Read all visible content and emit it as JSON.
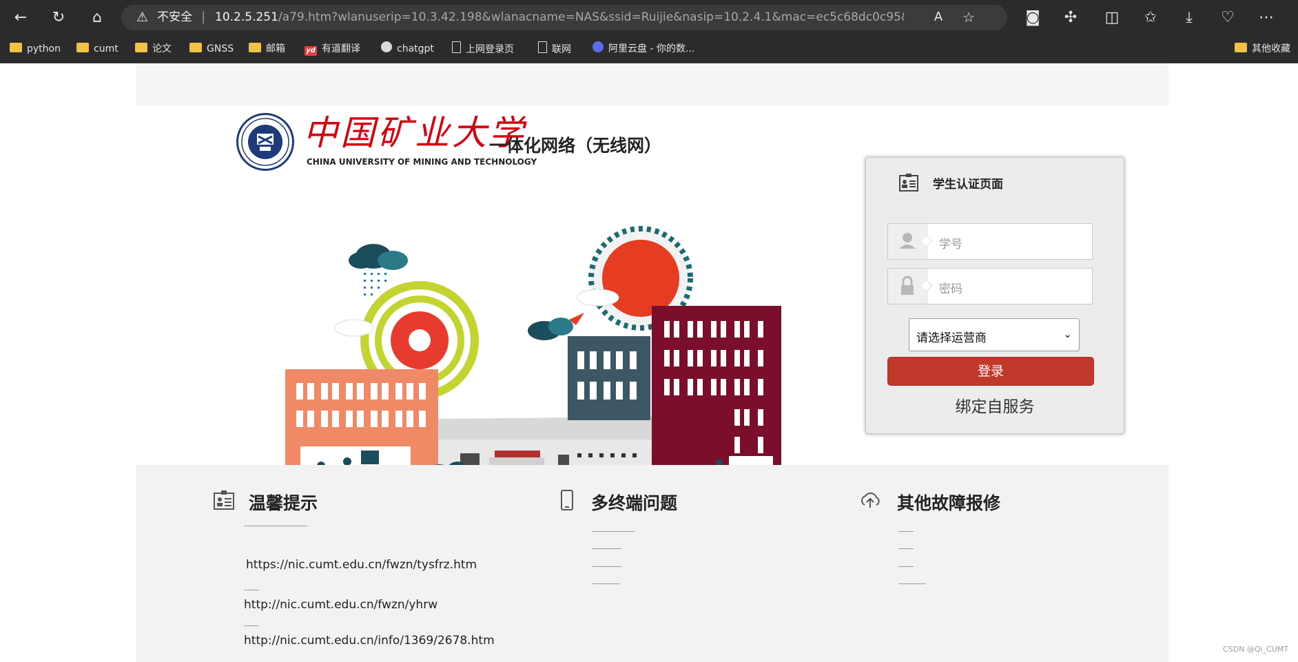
{
  "browser": {
    "security_label": "不安全",
    "url_host": "10.2.5.251",
    "url_rest": "/a79.htm?wlanuserip=10.3.42.198&wlanacname=NAS&ssid=Ruijie&nasip=10.2.4.1&mac=ec5c68dc0c95&t=wireless-v2-plai…",
    "bookmarks": [
      {
        "label": "python",
        "icon": "folder-icon"
      },
      {
        "label": "cumt",
        "icon": "folder-icon"
      },
      {
        "label": "论文",
        "icon": "folder-icon"
      },
      {
        "label": "GNSS",
        "icon": "folder-icon"
      },
      {
        "label": "邮箱",
        "icon": "folder-icon"
      },
      {
        "label": "有道翻译",
        "icon": "youdao-icon"
      },
      {
        "label": "chatgpt",
        "icon": "chatgpt-icon"
      },
      {
        "label": "上网登录页",
        "icon": "document-icon"
      },
      {
        "label": "联网",
        "icon": "document-icon"
      },
      {
        "label": "阿里云盘 - 你的数...",
        "icon": "aliyun-icon"
      }
    ],
    "other_bookmarks": "其他收藏"
  },
  "header": {
    "university_cn": "中国矿业大学",
    "university_en": "CHINA UNIVERSITY OF MINING AND TECHNOLOGY",
    "network_title": "一体化网络（无线网）"
  },
  "login": {
    "title": "学生认证页面",
    "username_placeholder": "学号",
    "password_placeholder": "密码",
    "carrier_select": "请选择运营商",
    "login_button": "登录",
    "bind_link": "绑定自服务"
  },
  "info": {
    "tips": {
      "title": "温馨提示",
      "links": [
        "https://nic.cumt.edu.cn/fwzn/tysfrz.htm",
        "http://nic.cumt.edu.cn/fwzn/yhrw",
        "http://nic.cumt.edu.cn/info/1369/2678.htm"
      ]
    },
    "multi_device": {
      "title": "多终端问题"
    },
    "repair": {
      "title": "其他故障报修"
    }
  },
  "watermark": "CSDN @Qi_CUMT"
}
